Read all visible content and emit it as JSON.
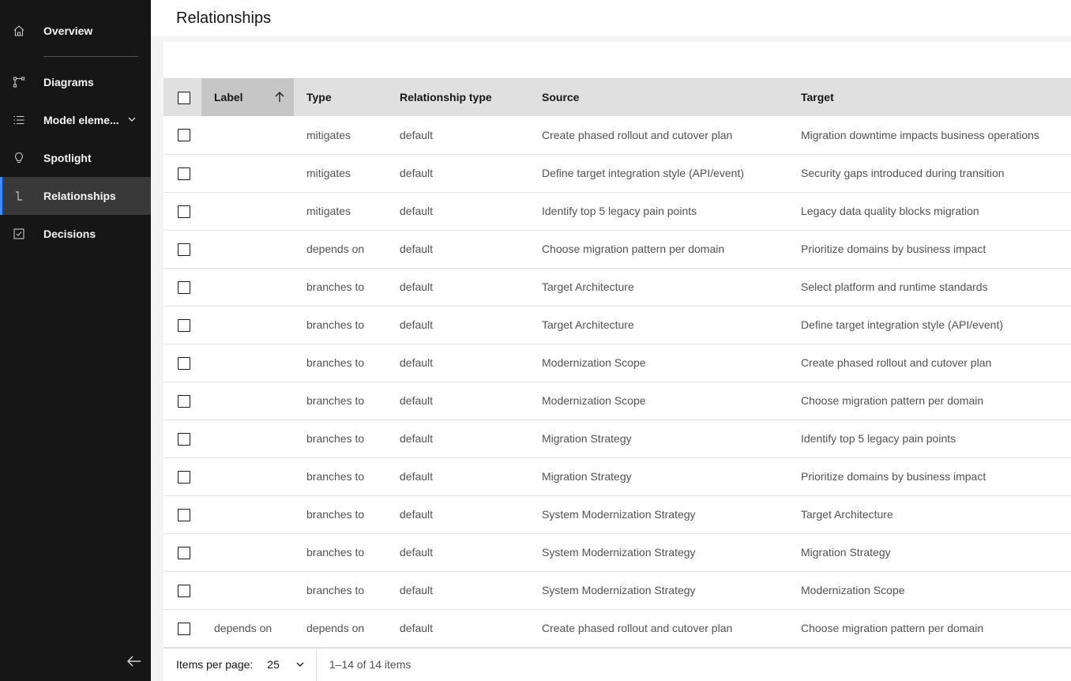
{
  "sidebar": {
    "items": [
      {
        "label": "Overview",
        "icon": "home-icon"
      },
      {
        "label": "Diagrams",
        "icon": "flow-icon"
      },
      {
        "label": "Model eleme...",
        "icon": "list-icon"
      },
      {
        "label": "Spotlight",
        "icon": "lightbulb-icon"
      },
      {
        "label": "Relationships",
        "icon": "connect-icon"
      },
      {
        "label": "Decisions",
        "icon": "checkbox-checked-icon"
      }
    ],
    "active": "Relationships"
  },
  "header": {
    "title": "Relationships"
  },
  "table": {
    "columns": [
      "Label",
      "Type",
      "Relationship type",
      "Source",
      "Target"
    ],
    "sort": {
      "column": "Label",
      "direction": "ascending"
    },
    "rows": [
      {
        "label": "",
        "type": "mitigates",
        "rel_type": "default",
        "source": "Create phased rollout and cutover plan",
        "target": "Migration downtime impacts business operations"
      },
      {
        "label": "",
        "type": "mitigates",
        "rel_type": "default",
        "source": "Define target integration style (API/event)",
        "target": "Security gaps introduced during transition"
      },
      {
        "label": "",
        "type": "mitigates",
        "rel_type": "default",
        "source": "Identify top 5 legacy pain points",
        "target": "Legacy data quality blocks migration"
      },
      {
        "label": "",
        "type": "depends on",
        "rel_type": "default",
        "source": "Choose migration pattern per domain",
        "target": "Prioritize domains by business impact"
      },
      {
        "label": "",
        "type": "branches to",
        "rel_type": "default",
        "source": "Target Architecture",
        "target": "Select platform and runtime standards"
      },
      {
        "label": "",
        "type": "branches to",
        "rel_type": "default",
        "source": "Target Architecture",
        "target": "Define target integration style (API/event)"
      },
      {
        "label": "",
        "type": "branches to",
        "rel_type": "default",
        "source": "Modernization Scope",
        "target": "Create phased rollout and cutover plan"
      },
      {
        "label": "",
        "type": "branches to",
        "rel_type": "default",
        "source": "Modernization Scope",
        "target": "Choose migration pattern per domain"
      },
      {
        "label": "",
        "type": "branches to",
        "rel_type": "default",
        "source": "Migration Strategy",
        "target": "Identify top 5 legacy pain points"
      },
      {
        "label": "",
        "type": "branches to",
        "rel_type": "default",
        "source": "Migration Strategy",
        "target": "Prioritize domains by business impact"
      },
      {
        "label": "",
        "type": "branches to",
        "rel_type": "default",
        "source": "System Modernization Strategy",
        "target": "Target Architecture"
      },
      {
        "label": "",
        "type": "branches to",
        "rel_type": "default",
        "source": "System Modernization Strategy",
        "target": "Migration Strategy"
      },
      {
        "label": "",
        "type": "branches to",
        "rel_type": "default",
        "source": "System Modernization Strategy",
        "target": "Modernization Scope"
      },
      {
        "label": "depends on",
        "type": "depends on",
        "rel_type": "default",
        "source": "Create phased rollout and cutover plan",
        "target": "Choose migration pattern per domain"
      }
    ]
  },
  "pagination": {
    "items_per_page_label": "Items per page:",
    "items_per_page": "25",
    "range_text": "1–14 of 14 items"
  },
  "colors": {
    "sidebar_bg": "#161616",
    "active_bg": "#393939",
    "accent": "#4589ff",
    "header_bg": "#e0e0e0",
    "sorted_header_bg": "#c6c6c6"
  }
}
